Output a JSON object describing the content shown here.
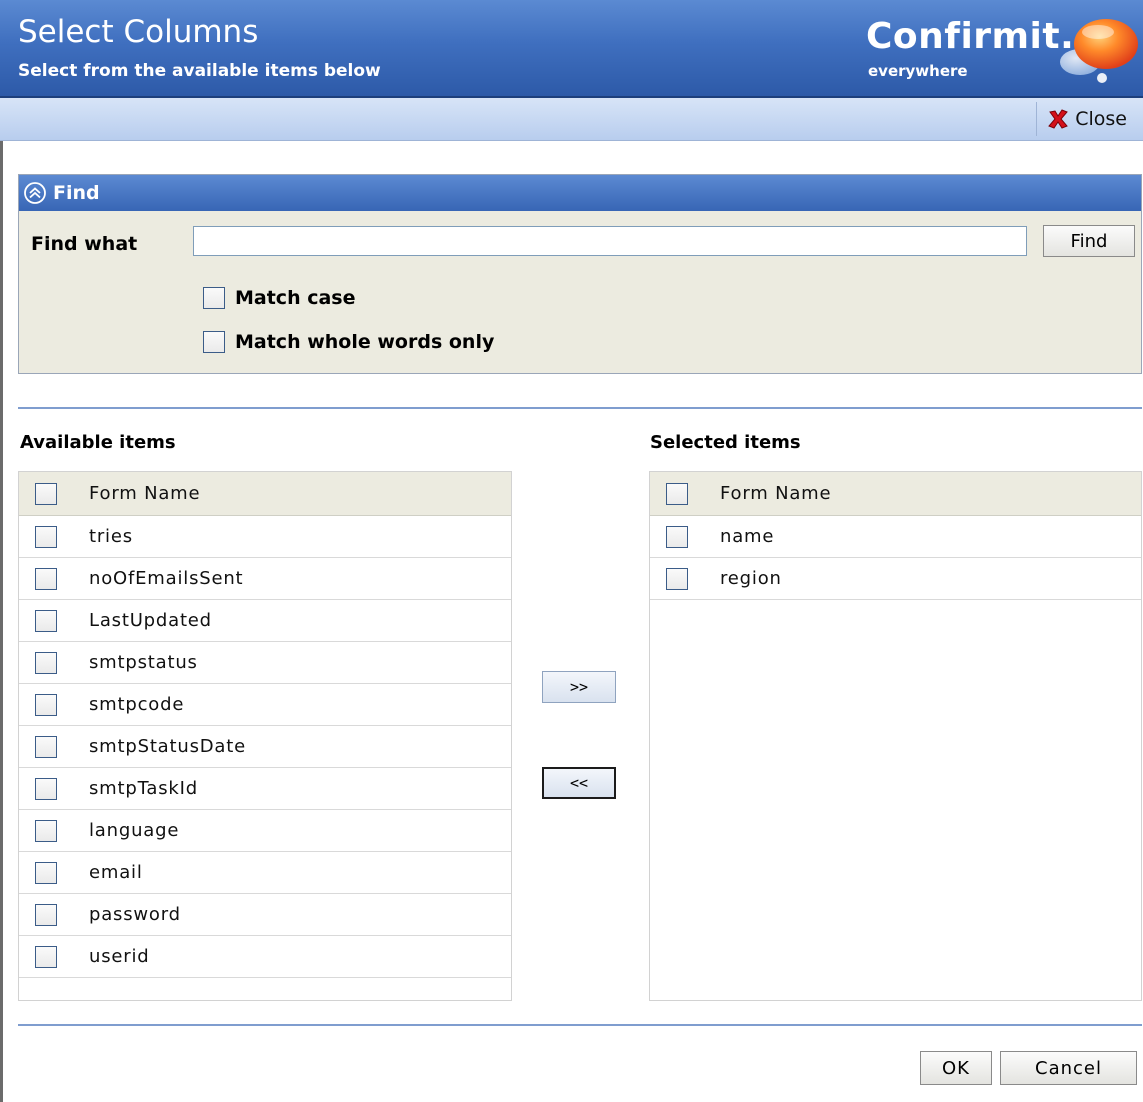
{
  "header": {
    "title": "Select Columns",
    "subtitle": "Select from the available items below",
    "logo_text": "Confirmit.",
    "logo_tagline": "everywhere"
  },
  "toolbar": {
    "close_label": "Close",
    "close_icon": "close-x-icon"
  },
  "find": {
    "section_title": "Find",
    "collapse_icon": "collapse-up-icon",
    "find_what_label": "Find what",
    "input_value": "",
    "button_label": "Find",
    "options": [
      {
        "label": "Match case",
        "checked": false
      },
      {
        "label": "Match whole words only",
        "checked": false
      }
    ]
  },
  "available": {
    "title": "Available items",
    "column_header": "Form Name",
    "items": [
      "tries",
      "noOfEmailsSent",
      "LastUpdated",
      "smtpstatus",
      "smtpcode",
      "smtpStatusDate",
      "smtpTaskId",
      "language",
      "email",
      "password",
      "userid"
    ]
  },
  "selected": {
    "title": "Selected items",
    "column_header": "Form Name",
    "items": [
      "name",
      "region"
    ]
  },
  "move": {
    "add_label": ">>",
    "remove_label": "<<"
  },
  "footer": {
    "ok_label": "OK",
    "cancel_label": "Cancel"
  },
  "colors": {
    "header_blue": "#3f6fbf",
    "panel_beige": "#ecebe0",
    "divider_blue": "#7f9dcf"
  }
}
